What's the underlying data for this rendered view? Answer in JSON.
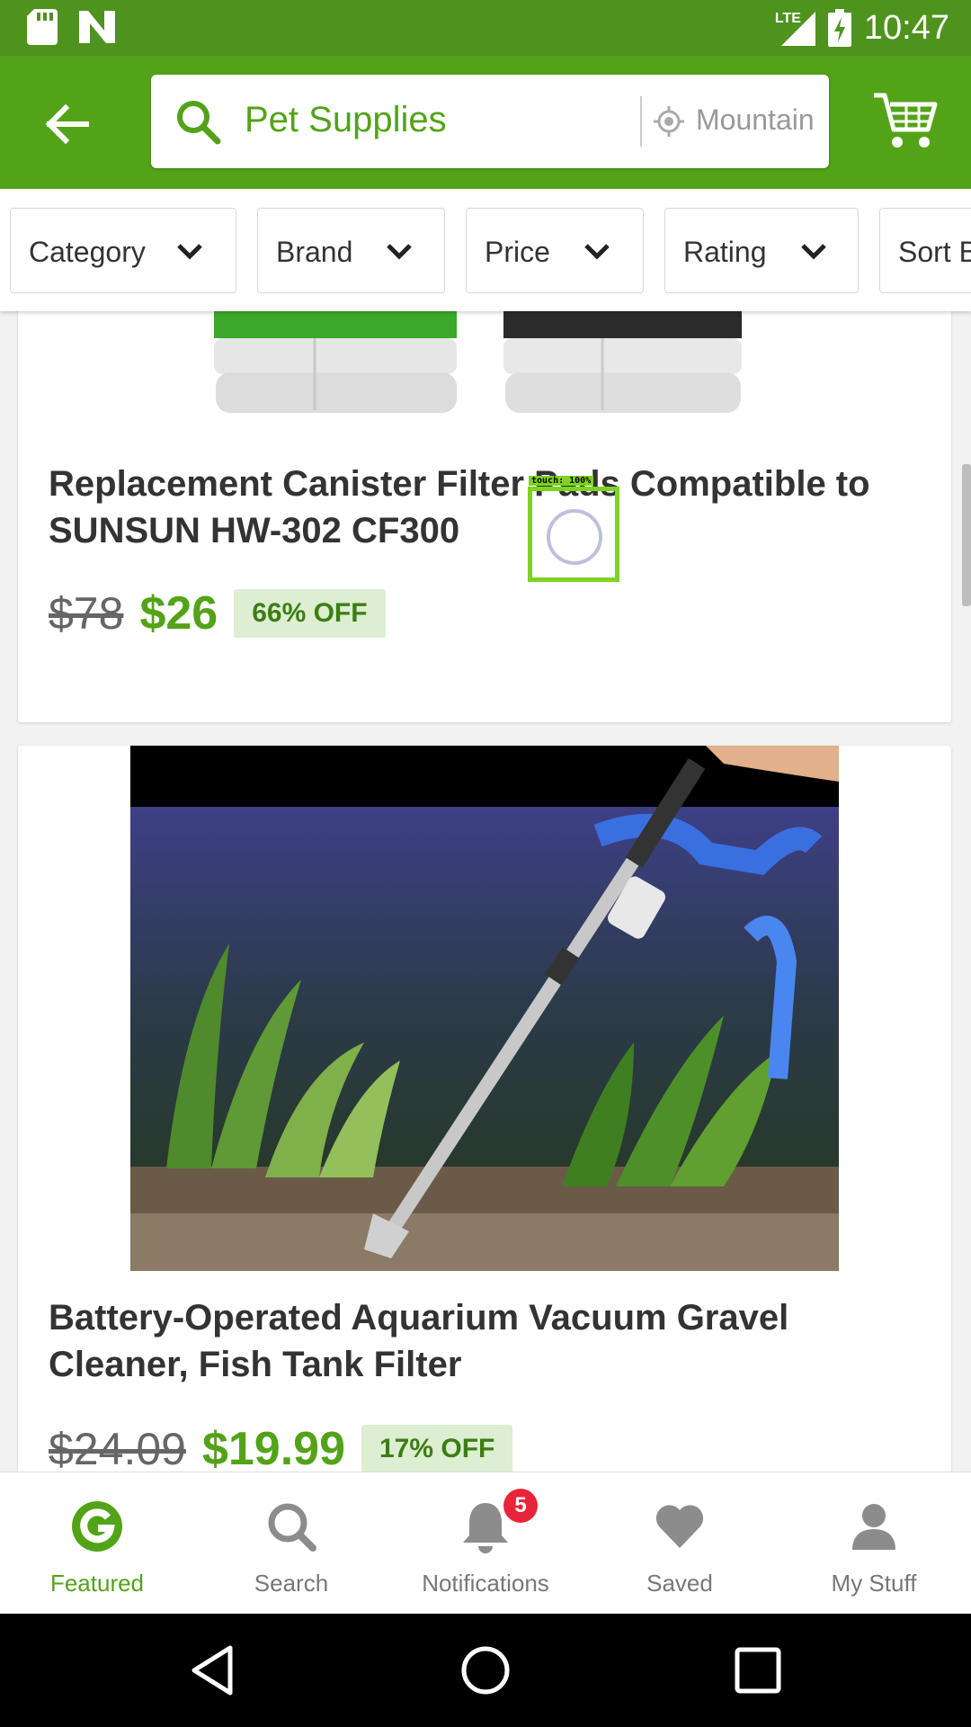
{
  "status_bar": {
    "time": "10:47",
    "network": "LTE",
    "icons": [
      "sd-card-icon",
      "n-icon",
      "signal-icon",
      "battery-charging-icon"
    ]
  },
  "app_bar": {
    "search_text": "Pet Supplies",
    "location_text": "Mountain"
  },
  "filters": [
    {
      "label": "Category"
    },
    {
      "label": "Brand"
    },
    {
      "label": "Price"
    },
    {
      "label": "Rating"
    },
    {
      "label": "Sort B"
    }
  ],
  "products": [
    {
      "title": "Replacement Canister Filter Pads Compatible to SUNSUN HW-302 CF300",
      "old_price": "$78",
      "new_price": "$26",
      "discount": "66% OFF"
    },
    {
      "title": "Battery-Operated Aquarium Vacuum Gravel Cleaner, Fish Tank Filter",
      "old_price": "$24.09",
      "new_price": "$19.99",
      "discount": "17% OFF"
    }
  ],
  "touch_indicator": {
    "label": "touch: 100%"
  },
  "bottom_nav": [
    {
      "label": "Featured",
      "icon": "g-logo-icon",
      "active": true
    },
    {
      "label": "Search",
      "icon": "search-icon",
      "active": false
    },
    {
      "label": "Notifications",
      "icon": "bell-icon",
      "active": false,
      "badge": "5"
    },
    {
      "label": "Saved",
      "icon": "heart-icon",
      "active": false
    },
    {
      "label": "My Stuff",
      "icon": "person-icon",
      "active": false
    }
  ],
  "colors": {
    "brand_green": "#53a318",
    "status_green": "#4e931d",
    "badge_red": "#e8243a"
  }
}
